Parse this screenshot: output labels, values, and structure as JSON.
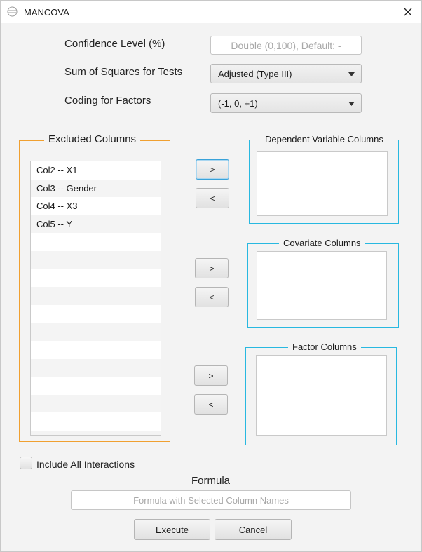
{
  "window": {
    "title": "MANCOVA",
    "app_icon": "app-logo-icon",
    "close_icon": "close-icon"
  },
  "options": {
    "confidence_label": "Confidence Level (%)",
    "confidence_placeholder": "Double (0,100), Default: -",
    "ss_label": "Sum of Squares for Tests",
    "ss_value": "Adjusted (Type III)",
    "coding_label": "Coding for Factors",
    "coding_value": "(-1, 0, +1)"
  },
  "excluded": {
    "title": "Excluded Columns",
    "items": [
      "Col2 -- X1",
      "Col3 -- Gender",
      "Col4 -- X3",
      "Col5 -- Y"
    ]
  },
  "dependent": {
    "title": "Dependent Variable Columns",
    "items": []
  },
  "covariate": {
    "title": "Covariate Columns",
    "items": []
  },
  "factor": {
    "title": "Factor Columns",
    "items": []
  },
  "move": {
    "add": ">",
    "remove": "<"
  },
  "interactions": {
    "label": "Include All Interactions",
    "checked": false
  },
  "formula": {
    "label": "Formula",
    "placeholder": "Formula with Selected Column Names"
  },
  "actions": {
    "execute": "Execute",
    "cancel": "Cancel"
  },
  "colors": {
    "excluded_border": "#f0a030",
    "target_border": "#28b8e0"
  }
}
